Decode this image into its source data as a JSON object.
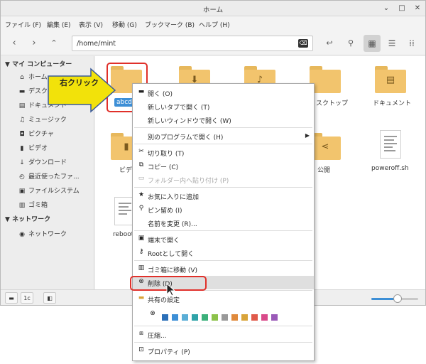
{
  "window": {
    "title": "ホーム"
  },
  "menubar": [
    "ファイル (F)",
    "編集 (E)",
    "表示 (V)",
    "移動 (G)",
    "ブックマーク (B)",
    "ヘルプ (H)"
  ],
  "location": {
    "path": "/home/mint"
  },
  "sidebar": {
    "computer_header": "マイ コンピューター",
    "computer_items": [
      {
        "label": "ホーム",
        "icon": "home-icon"
      },
      {
        "label": "デスクト",
        "icon": "desktop-icon"
      },
      {
        "label": "ドキュメント",
        "icon": "document-icon"
      },
      {
        "label": "ミュージック",
        "icon": "music-icon"
      },
      {
        "label": "ピクチャ",
        "icon": "camera-icon"
      },
      {
        "label": "ビデオ",
        "icon": "video-icon"
      },
      {
        "label": "ダウンロード",
        "icon": "download-icon"
      },
      {
        "label": "最近使ったファ...",
        "icon": "clock-icon"
      },
      {
        "label": "ファイルシステム",
        "icon": "drive-icon"
      },
      {
        "label": "ゴミ箱",
        "icon": "trash-icon"
      }
    ],
    "network_header": "ネットワーク",
    "network_items": [
      {
        "label": "ネットワーク",
        "icon": "network-icon"
      }
    ]
  },
  "files": [
    {
      "label": "abcd",
      "selected": true
    },
    {
      "label": "",
      "emblem": "download-icon"
    },
    {
      "label": "",
      "emblem": "music-icon"
    },
    {
      "label": "スクトップ"
    },
    {
      "label": "ドキュメント",
      "emblem": "document-icon"
    },
    {
      "label": "ビデ"
    },
    {
      "label": "公開",
      "emblem": "share-icon"
    },
    {
      "label": "poweroff.sh"
    },
    {
      "label": "reboot"
    }
  ],
  "callout": {
    "text": "右クリック"
  },
  "context_menu": [
    {
      "label": "開く (O)",
      "icon": "folder-open-icon"
    },
    {
      "label": "新しいタブで開く (T)",
      "icon": ""
    },
    {
      "label": "新しいウィンドウで開く (W)",
      "icon": ""
    },
    {
      "label": "別のプログラムで開く (H)",
      "icon": "",
      "submenu": true
    },
    {
      "label": "切り取り (T)",
      "icon": "scissors-icon"
    },
    {
      "label": "コピー (C)",
      "icon": "copy-icon"
    },
    {
      "label": "フォルダー内へ貼り付け (P)",
      "icon": "paste-icon",
      "disabled": true
    },
    {
      "label": "お気に入りに追加",
      "icon": "star-icon"
    },
    {
      "label": "ピン留め (I)",
      "icon": "pin-icon"
    },
    {
      "label": "名前を変更 (R)...",
      "icon": ""
    },
    {
      "label": "端末で開く",
      "icon": "terminal-icon"
    },
    {
      "label": "Rootとして開く",
      "icon": "key-icon"
    },
    {
      "label": "ゴミ箱に移動 (V)",
      "icon": "trash-icon"
    },
    {
      "label": "削除 (D)",
      "icon": "delete-icon",
      "highlighted": true
    },
    {
      "label": "共有の設定",
      "icon": "share-folder-icon"
    },
    {
      "label": "圧縮...",
      "icon": "compress-icon"
    },
    {
      "label": "プロパティ (P)",
      "icon": "properties-icon"
    }
  ],
  "folder_colors": [
    "#2b6fb8",
    "#3d8fd6",
    "#5aaed6",
    "#2fa3a8",
    "#3bb07a",
    "#8cc24a",
    "#999999",
    "#e08a3c",
    "#d9a43a",
    "#e05a4a",
    "#d94a8a",
    "#9a5ab8"
  ],
  "colors": {
    "folder": "#f2c46d",
    "selection": "#3d8fd6",
    "callout_arrow": "#f2e20a",
    "callout_border": "#e0302a"
  },
  "statusbar": {
    "sidebar_toggle": "1c"
  }
}
